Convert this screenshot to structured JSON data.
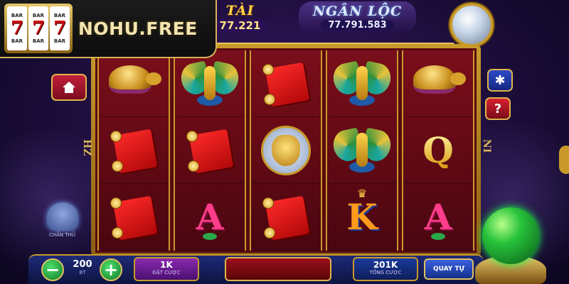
{
  "logo": {
    "digits": [
      "7",
      "7",
      "7"
    ],
    "reel_tag": "BAR",
    "text": "NOHU.FREE"
  },
  "jackpots": {
    "left": {
      "title": "TÀI",
      "value": "77.221"
    },
    "middle": {
      "title": "NGÂN LỘC",
      "value": "77.791.583"
    }
  },
  "reels": [
    [
      "turtle",
      "red-envelope",
      "red-envelope"
    ],
    [
      "phoenix",
      "red-envelope",
      "A"
    ],
    [
      "red-envelope",
      "dragon-coin",
      "red-envelope"
    ],
    [
      "phoenix",
      "phoenix",
      "K"
    ],
    [
      "turtle",
      "Q",
      "A"
    ]
  ],
  "side_glyphs": {
    "left": "HZ",
    "right": "NI"
  },
  "statue_label": "CHẤN THỦ",
  "bottom_bar": {
    "minus_label": "−",
    "plus_label": "+",
    "bet_value": "200",
    "bet_sub": "BT",
    "total_value": "1K",
    "total_sub": "ĐẶT CƯỢC",
    "win_value": "201K",
    "win_sub": "TỔNG CƯỢC",
    "auto_label": "QUAY TỰ"
  },
  "colors": {
    "gold": "#c99a2a",
    "reel_bg": "#7a0e1a",
    "spin_green": "#27c23a"
  }
}
